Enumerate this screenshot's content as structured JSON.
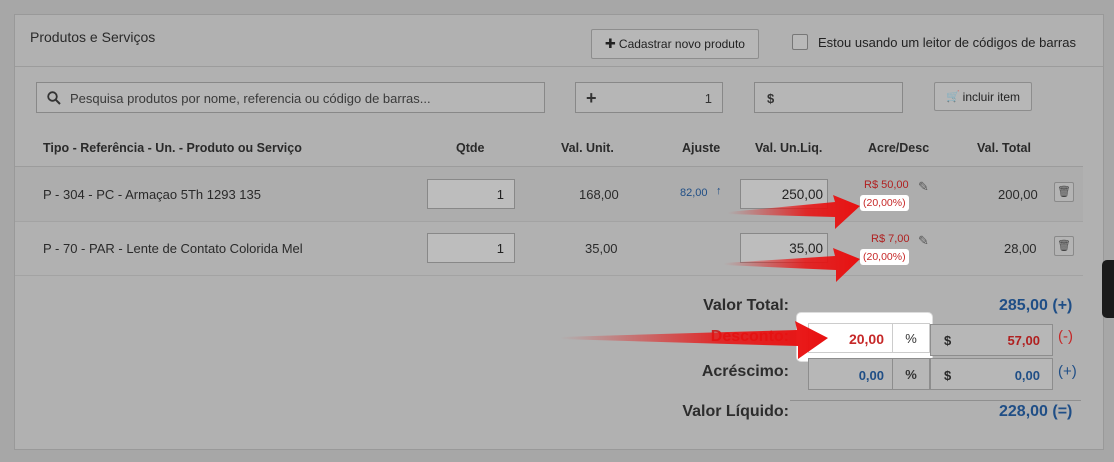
{
  "panel": {
    "title": "Produtos e Serviços",
    "new_product_label": "Cadastrar novo produto",
    "barcode_label": "Estou usando um leitor de códigos de barras"
  },
  "search": {
    "placeholder": "Pesquisa produtos por nome, referencia ou código de barras...",
    "qty_value": "1",
    "price_prefix": "$",
    "price_value": "",
    "include_label": "incluir item"
  },
  "table": {
    "headers": [
      "Tipo - Referência - Un. - Produto ou Serviço",
      "Qtde",
      "Val. Unit.",
      "Ajuste",
      "Val. Un.Liq.",
      "Acre/Desc",
      "Val. Total"
    ],
    "rows": [
      {
        "product": "P - 304 - PC - Armaçao 5Th 1293 135",
        "qty": "1",
        "unit": "168,00",
        "adjust": "82,00",
        "liq": "250,00",
        "acre_money": "R$ 50,00",
        "acre_pct": "(20,00%)",
        "total": "200,00"
      },
      {
        "product": "P - 70 - PAR - Lente de Contato Colorida Mel",
        "qty": "1",
        "unit": "35,00",
        "adjust": "",
        "liq": "35,00",
        "acre_money": "R$ 7,00",
        "acre_pct": "(20,00%)",
        "total": "28,00"
      }
    ]
  },
  "summary": {
    "total_label": "Valor Total:",
    "total_value": "285,00 (+)",
    "discount_label": "Desconto:",
    "discount_pct": "20,00",
    "pct_symbol": "%",
    "currency": "$",
    "discount_money": "57,00",
    "discount_sign": "(-)",
    "addition_label": "Acréscimo:",
    "addition_pct": "0,00",
    "addition_money": "0,00",
    "addition_sign": "(+)",
    "net_label": "Valor Líquido:",
    "net_value": "228,00 (=)"
  },
  "colors": {
    "accent_blue": "#1f4e86",
    "discount_red": "#c62828",
    "arrow_red": "#e81010"
  }
}
